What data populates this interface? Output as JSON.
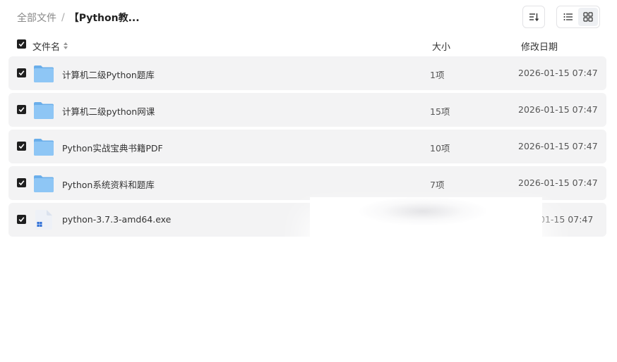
{
  "breadcrumb": {
    "root": "全部文件",
    "separator": "/",
    "current": "【Python教..."
  },
  "toolbar": {
    "sort_icon": "sort-list-icon",
    "view_list_icon": "list-view-icon",
    "view_grid_icon": "grid-view-icon",
    "active_view": "list"
  },
  "header": {
    "name": "文件名",
    "size": "大小",
    "date": "修改日期",
    "all_checked": true
  },
  "files": [
    {
      "name": "计算机二级Python题库",
      "size": "1项",
      "date": "2026-01-15 07:47",
      "type": "folder",
      "checked": true
    },
    {
      "name": "计算机二级python网课",
      "size": "15项",
      "date": "2026-01-15 07:47",
      "type": "folder",
      "checked": true
    },
    {
      "name": "Python实战宝典书籍PDF",
      "size": "10项",
      "date": "2026-01-15 07:47",
      "type": "folder",
      "checked": true
    },
    {
      "name": "Python系统资料和题库",
      "size": "7项",
      "date": "2026-01-15 07:47",
      "type": "folder",
      "checked": true
    },
    {
      "name": "python-3.7.3-amd64.exe",
      "size": "",
      "date": "01-15 07:47",
      "type": "exe",
      "checked": true
    }
  ],
  "colors": {
    "row_bg": "#f3f3f4",
    "checkbox": "#1f1f1f",
    "folder": "#7fb8f0"
  }
}
